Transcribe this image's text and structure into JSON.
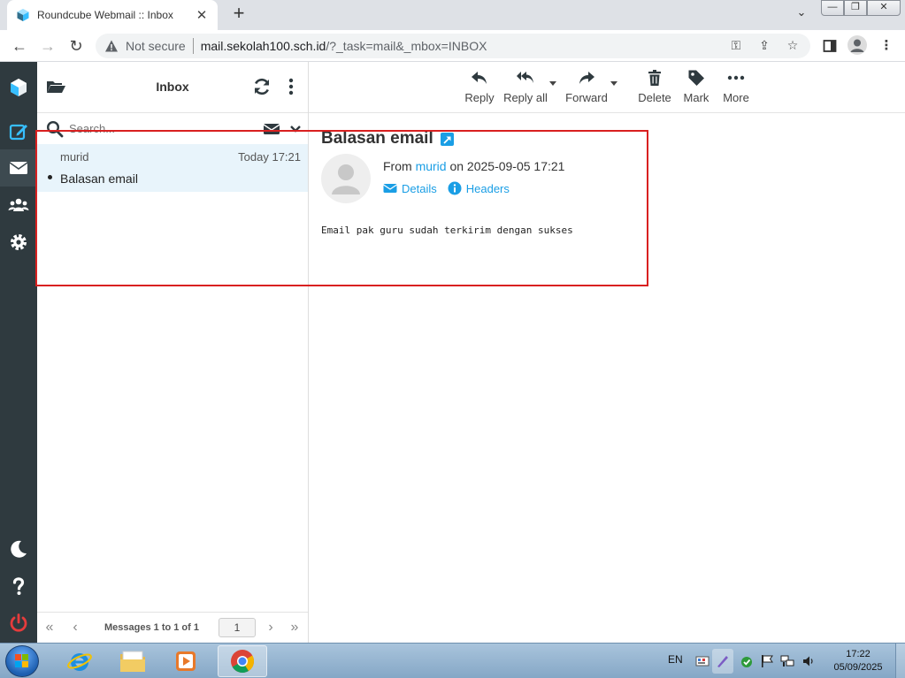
{
  "browser": {
    "tab_title": "Roundcube Webmail :: Inbox",
    "not_secure_label": "Not secure",
    "url_host": "mail.sekolah100.sch.id",
    "url_path": "/?_task=mail&_mbox=INBOX"
  },
  "mail_list": {
    "title": "Inbox",
    "search_placeholder": "Search...",
    "messages": [
      {
        "from": "murid",
        "date": "Today 17:21",
        "subject": "Balasan email"
      }
    ],
    "pagination": {
      "count_text": "Messages 1 to 1 of 1",
      "page": "1"
    }
  },
  "toolbar": {
    "reply": "Reply",
    "reply_all": "Reply all",
    "forward": "Forward",
    "delete": "Delete",
    "mark": "Mark",
    "more": "More"
  },
  "message": {
    "subject": "Balasan email",
    "from_label": "From",
    "from_name": "murid",
    "date_text": "on 2025-09-05 17:21",
    "details_label": "Details",
    "headers_label": "Headers",
    "body": "Email pak guru sudah terkirim dengan sukses"
  },
  "taskbar": {
    "language": "EN",
    "time": "17:22",
    "date": "05/09/2025"
  },
  "colors": {
    "accent": "#1a9ee5",
    "rail": "#2f3a3f",
    "highlight": "#d92020",
    "selected_row": "#e8f4fb"
  }
}
